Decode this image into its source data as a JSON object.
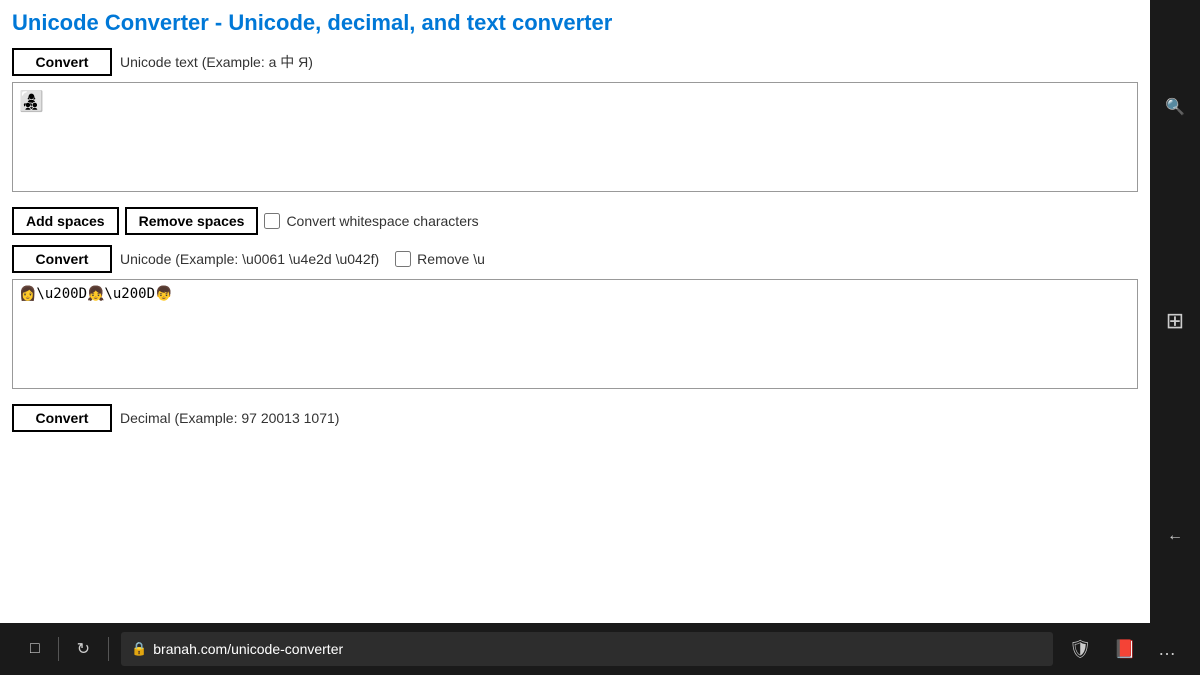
{
  "page": {
    "title": "Unicode Converter - Unicode, decimal, and text converter"
  },
  "section1": {
    "convert_label": "Convert",
    "input_placeholder": "Unicode text (Example: a 中 Я)",
    "textarea_content": "👩‍👧‍👦"
  },
  "section2": {
    "add_spaces_label": "Add spaces",
    "remove_spaces_label": "Remove spaces",
    "convert_whitespace_label": "Convert whitespace characters"
  },
  "section3": {
    "convert_label": "Convert",
    "input_placeholder": "Unicode (Example: \\u0061 \\u4e2d \\u042f)",
    "remove_label": "Remove \\u",
    "textarea_content": "👩‍👧‍👦"
  },
  "section4": {
    "convert_label": "Convert",
    "input_placeholder": "Decimal (Example: 97 20013 1071)"
  },
  "taskbar": {
    "url": "branah.com/unicode-converter"
  },
  "icons": {
    "search": "🔍",
    "windows": "⊞",
    "back": "←",
    "tab": "⬜",
    "refresh": "↺",
    "lock": "🔒",
    "shield": "🛡",
    "book": "📖",
    "more": "..."
  }
}
